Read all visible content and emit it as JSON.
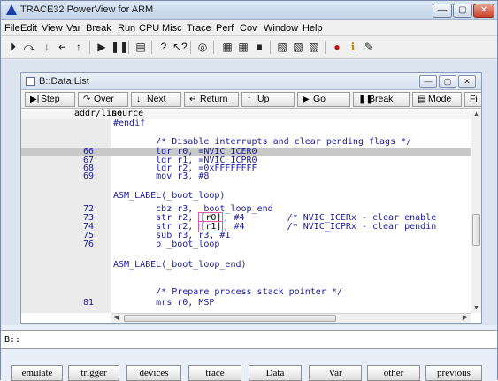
{
  "window": {
    "title": "TRACE32 PowerView for ARM"
  },
  "menu": [
    "File",
    "Edit",
    "View",
    "Var",
    "Break",
    "Run",
    "CPU",
    "Misc",
    "Trace",
    "Perf",
    "Cov",
    "Window",
    "Help"
  ],
  "child_window": {
    "title": "B::Data.List"
  },
  "list_buttons": [
    {
      "label": "Step",
      "glyph": "▶|"
    },
    {
      "label": "Over",
      "glyph": "↷"
    },
    {
      "label": "Next",
      "glyph": "↓"
    },
    {
      "label": "Return",
      "glyph": "↵"
    },
    {
      "label": "Up",
      "glyph": "↑"
    },
    {
      "label": "Go",
      "glyph": "▶"
    },
    {
      "label": "Break",
      "glyph": "❚❚"
    },
    {
      "label": "Mode",
      "glyph": "▤"
    },
    {
      "label": "Fi",
      "glyph": ""
    }
  ],
  "list_header": {
    "col1": "addr/line",
    "col2": "source"
  },
  "code_rows": [
    {
      "line": "",
      "src": "#endif"
    },
    {
      "line": "",
      "src": ""
    },
    {
      "line": "",
      "src": "        /* Disable interrupts and clear pending flags */"
    },
    {
      "line": "66",
      "src": "        ldr r0, =NVIC_ICER0",
      "highlight": true
    },
    {
      "line": "67",
      "src": "        ldr r1, =NVIC_ICPR0"
    },
    {
      "line": "68",
      "src": "        ldr r2, =0xFFFFFFFF"
    },
    {
      "line": "69",
      "src": "        mov r3, #8"
    },
    {
      "line": "",
      "src": ""
    },
    {
      "line": "",
      "src": "ASM_LABEL(_boot_loop)"
    },
    {
      "line": "72",
      "src": "        cbz r3, _boot_loop_end"
    },
    {
      "line": "73",
      "src_a": "        str r2, ",
      "src_b": "[r0]",
      "src_c": ", #4        /* NVIC_ICERx - clear enable"
    },
    {
      "line": "74",
      "src_a": "        str r2, ",
      "src_b": "[r1]",
      "src_c": ", #4        /* NVIC_ICPRx - clear pendin"
    },
    {
      "line": "75",
      "src": "        sub r3, r3, #1"
    },
    {
      "line": "76",
      "src": "        b _boot_loop"
    },
    {
      "line": "",
      "src": ""
    },
    {
      "line": "",
      "src": "ASM_LABEL(_boot_loop_end)"
    },
    {
      "line": "",
      "src": ""
    },
    {
      "line": "",
      "src": "        /* Prepare process stack pointer */"
    },
    {
      "line": "81",
      "src": "        mrs r0, MSP"
    }
  ],
  "command_line": {
    "prompt": "B::",
    "value": ""
  },
  "softkeys": [
    "emulate",
    "trigger",
    "devices",
    "trace",
    "Data",
    "Var",
    "other",
    "previous"
  ]
}
